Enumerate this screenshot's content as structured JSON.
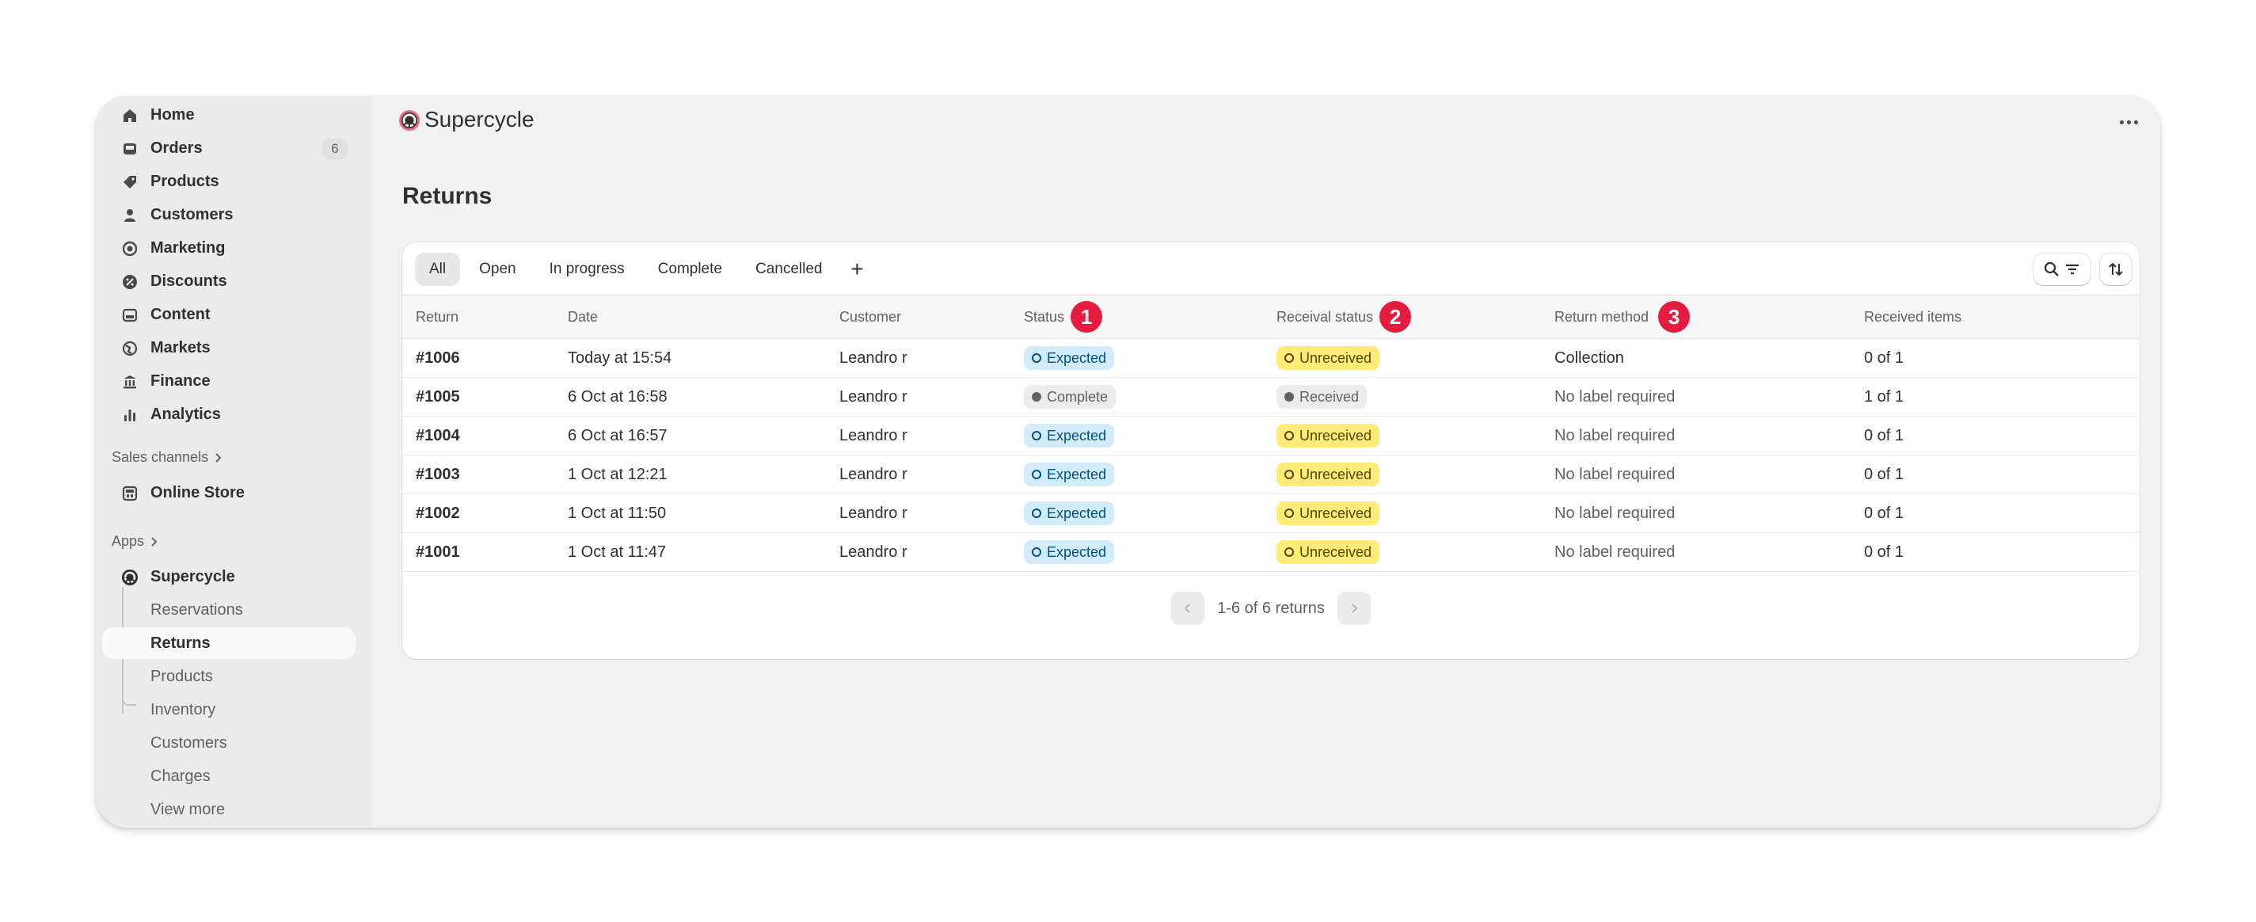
{
  "sidebar": {
    "nav": [
      {
        "label": "Home",
        "icon": "home-icon"
      },
      {
        "label": "Orders",
        "icon": "inbox-icon",
        "badge": "6"
      },
      {
        "label": "Products",
        "icon": "tag-icon"
      },
      {
        "label": "Customers",
        "icon": "person-icon"
      },
      {
        "label": "Marketing",
        "icon": "target-icon"
      },
      {
        "label": "Discounts",
        "icon": "discount-icon"
      },
      {
        "label": "Content",
        "icon": "image-icon"
      },
      {
        "label": "Markets",
        "icon": "globe-icon"
      },
      {
        "label": "Finance",
        "icon": "bank-icon"
      },
      {
        "label": "Analytics",
        "icon": "bar-chart-icon"
      }
    ],
    "sales_channels_title": "Sales channels",
    "online_store": "Online Store",
    "apps_title": "Apps",
    "app_name": "Supercycle",
    "app_subitems": [
      {
        "label": "Reservations"
      },
      {
        "label": "Returns",
        "active": true
      },
      {
        "label": "Products"
      },
      {
        "label": "Inventory"
      },
      {
        "label": "Customers"
      },
      {
        "label": "Charges"
      },
      {
        "label": "View more"
      }
    ]
  },
  "header": {
    "app_title": "Supercycle"
  },
  "page": {
    "title": "Returns"
  },
  "tabs": [
    {
      "label": "All",
      "active": true
    },
    {
      "label": "Open"
    },
    {
      "label": "In progress"
    },
    {
      "label": "Complete"
    },
    {
      "label": "Cancelled"
    }
  ],
  "tab_add_label": "+",
  "table": {
    "columns": [
      "Return",
      "Date",
      "Customer",
      "Status",
      "Receival status",
      "Return method",
      "Received items"
    ],
    "annotations": [
      "1",
      "2",
      "3"
    ],
    "rows": [
      {
        "id": "#1006",
        "date": "Today at 15:54",
        "customer": "Leandro r",
        "status": "Expected",
        "receival": "Unreceived",
        "method": "Collection",
        "received": "0 of 1"
      },
      {
        "id": "#1005",
        "date": "6 Oct at 16:58",
        "customer": "Leandro r",
        "status": "Complete",
        "receival": "Received",
        "method": "No label required",
        "received": "1 of 1"
      },
      {
        "id": "#1004",
        "date": "6 Oct at 16:57",
        "customer": "Leandro r",
        "status": "Expected",
        "receival": "Unreceived",
        "method": "No label required",
        "received": "0 of 1"
      },
      {
        "id": "#1003",
        "date": "1 Oct at 12:21",
        "customer": "Leandro r",
        "status": "Expected",
        "receival": "Unreceived",
        "method": "No label required",
        "received": "0 of 1"
      },
      {
        "id": "#1002",
        "date": "1 Oct at 11:50",
        "customer": "Leandro r",
        "status": "Expected",
        "receival": "Unreceived",
        "method": "No label required",
        "received": "0 of 1"
      },
      {
        "id": "#1001",
        "date": "1 Oct at 11:47",
        "customer": "Leandro r",
        "status": "Expected",
        "receival": "Unreceived",
        "method": "No label required",
        "received": "0 of 1"
      }
    ]
  },
  "pagination": {
    "text": "1-6 of 6 returns"
  },
  "colors": {
    "expected_bg": "#d3ecfc",
    "unreceived_bg": "#ffeb78",
    "complete_bg": "#ececec",
    "annotation_red": "#e51c3f"
  }
}
